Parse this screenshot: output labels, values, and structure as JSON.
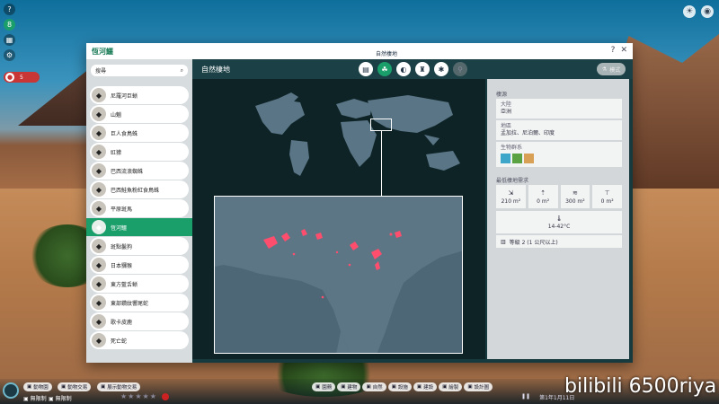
{
  "window": {
    "title": "恆河鱷",
    "help": "?",
    "close": "✕"
  },
  "tooltip": "自然棲地",
  "search": {
    "placeholder": "搜尋"
  },
  "species": [
    {
      "name": "尼羅河巨蜥",
      "icon": "lizard-icon"
    },
    {
      "name": "山魈",
      "icon": "primate-icon"
    },
    {
      "name": "巨人食鳥蛛",
      "icon": "spider-icon"
    },
    {
      "name": "豇獴",
      "icon": "mongoose-icon"
    },
    {
      "name": "巴西流浪蜘蛛",
      "icon": "spider-icon"
    },
    {
      "name": "巴西鮭魚粉紅食鳥蛛",
      "icon": "spider-icon"
    },
    {
      "name": "平原斑馬",
      "icon": "zebra-icon"
    },
    {
      "name": "恆河鱷",
      "icon": "gharial-icon"
    },
    {
      "name": "斑點鬣狗",
      "icon": "hyena-icon"
    },
    {
      "name": "日本獼猴",
      "icon": "macaque-icon"
    },
    {
      "name": "東方藍舌蜥",
      "icon": "lizard-icon"
    },
    {
      "name": "東部鑽紋響尾蛇",
      "icon": "snake-icon"
    },
    {
      "name": "歌卡皮鹿",
      "icon": "okapi-icon"
    },
    {
      "name": "死亡蛇",
      "icon": "snake-icon"
    }
  ],
  "active_species_index": 7,
  "content": {
    "title": "自然棲地",
    "tabs": [
      {
        "name": "tab-overview",
        "glyph": "▤",
        "state": "normal"
      },
      {
        "name": "tab-habitat",
        "glyph": "☘",
        "state": "active"
      },
      {
        "name": "tab-diet",
        "glyph": "◐",
        "state": "normal"
      },
      {
        "name": "tab-enrichment",
        "glyph": "♜",
        "state": "normal"
      },
      {
        "name": "tab-social",
        "glyph": "✱",
        "state": "normal"
      },
      {
        "name": "tab-breeding",
        "glyph": "⚲",
        "state": "disabled"
      }
    ],
    "mode_label": "模式"
  },
  "info": {
    "region_header": "棲源",
    "continent_label": "大陸",
    "continent_value": "亞洲",
    "area_label": "地區",
    "area_value": "孟加拉、尼泊爾、印度",
    "biome_label": "生物群系",
    "biome_colors": [
      "#3ea6c8",
      "#5aa242",
      "#d7a054"
    ],
    "req_header": "最低棲地需求",
    "req": [
      {
        "icon": "land-area-icon",
        "glyph": "⇲",
        "value": "210 m²"
      },
      {
        "icon": "climb-area-icon",
        "glyph": "⇡",
        "value": "0 m²"
      },
      {
        "icon": "water-area-icon",
        "glyph": "≋",
        "value": "300 m²"
      },
      {
        "icon": "deep-water-icon",
        "glyph": "⊤",
        "value": "0 m²"
      }
    ],
    "temperature": "14-42°C",
    "barrier_level": "等級 2 (1 公尺以上)"
  },
  "bottom": {
    "pill1": "動物園",
    "pill2": "動物交易",
    "pill3": "展示動物交易",
    "money": "無限制",
    "guests": "無限制",
    "nav": [
      "園務",
      "建物",
      "自然",
      "設施",
      "建設",
      "繪製",
      "設計圖"
    ],
    "date": "第1年1月11日"
  },
  "watermark": "bilibili 6500riya"
}
